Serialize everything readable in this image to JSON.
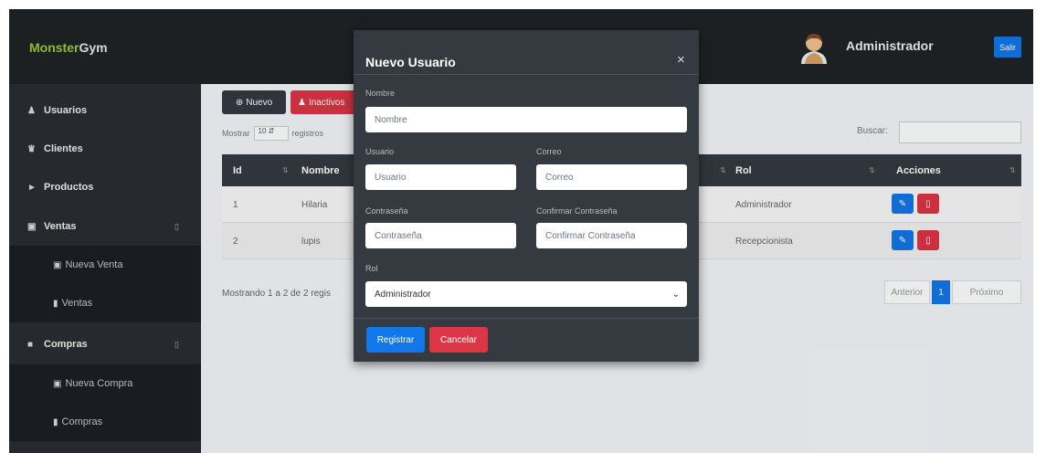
{
  "navbar": {
    "brand_part1": "Monster",
    "brand_part2": "Gym",
    "user_name": "Administrador",
    "logout_label": "Salir"
  },
  "sidebar": {
    "items": [
      {
        "label": "Usuarios",
        "icon": "users-icon"
      },
      {
        "label": "Clientes",
        "icon": "clients-icon"
      },
      {
        "label": "Productos",
        "icon": "tags-icon"
      },
      {
        "label": "Ventas",
        "icon": "cart-icon",
        "caret": "▯"
      },
      {
        "label": "Nueva Venta",
        "icon": "cart-icon"
      },
      {
        "label": "Ventas",
        "icon": "file-icon"
      },
      {
        "label": "Compras",
        "icon": "bag-icon",
        "caret": "▯"
      },
      {
        "label": "Nueva Compra",
        "icon": "cart-icon"
      },
      {
        "label": "Compras",
        "icon": "file-icon"
      }
    ]
  },
  "toolbar": {
    "new_label": "Nuevo",
    "inactive_label": "Inactivos"
  },
  "table_controls": {
    "show_label": "Mostrar",
    "show_value": "10",
    "records_label": "registros",
    "search_label": "Buscar:",
    "showing_text": "Mostrando 1 a 2 de 2 regis"
  },
  "table": {
    "headers": [
      "Id",
      "Nombre",
      "Rol",
      "Acciones"
    ],
    "rows": [
      {
        "id": "1",
        "nombre": "Hilaria",
        "rol": "Administrador"
      },
      {
        "id": "2",
        "nombre": "lupis",
        "rol": "Recepcionista"
      }
    ]
  },
  "pagination": {
    "previous": "Anterior",
    "current": "1",
    "next": "Próximo"
  },
  "modal": {
    "title": "Nuevo Usuario",
    "close": "×",
    "nombre_label": "Nombre",
    "nombre_placeholder": "Nombre",
    "usuario_label": "Usuario",
    "usuario_placeholder": "Usuario",
    "correo_label": "Correo",
    "correo_placeholder": "Correo",
    "password_label": "Contraseña",
    "password_placeholder": "Contraseña",
    "confirm_label": "Confirmar Contraseña",
    "confirm_placeholder": "Confirmar Contraseña",
    "rol_label": "Rol",
    "rol_value": "Administrador",
    "register_label": "Registrar",
    "cancel_label": "Cancelar"
  },
  "colors": {
    "primary": "#1277e8",
    "danger": "#dc3545",
    "dark": "#343a40",
    "brand_green": "#9acd32"
  }
}
